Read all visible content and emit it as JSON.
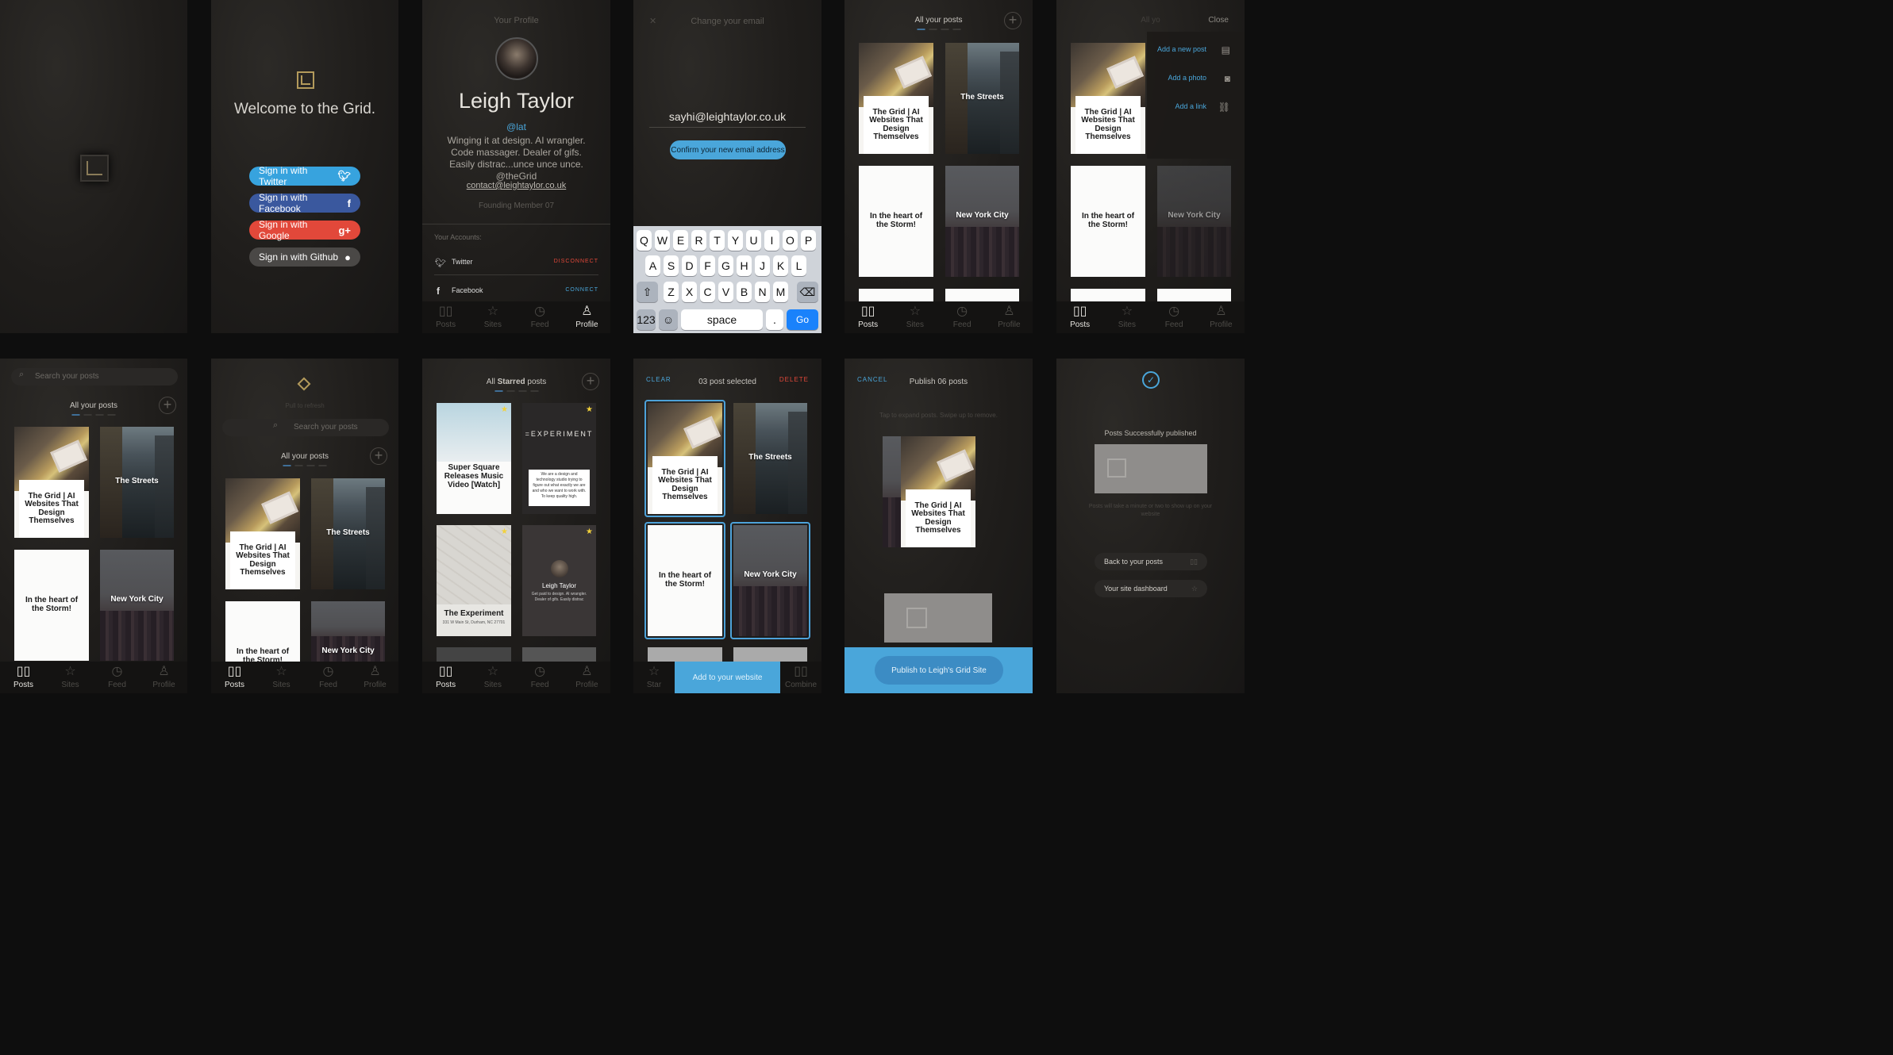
{
  "accent_blue": "#4aa6da",
  "s1": {
    "logo": "grid-logo"
  },
  "s2": {
    "welcome": "Welcome to the Grid.",
    "buttons": [
      {
        "label": "Sign in with Twitter",
        "icon": "twitter-icon",
        "color": "#37a3de"
      },
      {
        "label": "Sign in with Facebook",
        "icon": "facebook-icon",
        "color": "#3a589e"
      },
      {
        "label": "Sign in with Google",
        "icon": "google-plus-icon",
        "color": "#e2483a"
      },
      {
        "label": "Sign in with Github",
        "icon": "github-icon",
        "color": "#4a4846"
      }
    ]
  },
  "s3": {
    "header": "Your Profile",
    "name": "Leigh Taylor",
    "handle": "@lat",
    "bio": "Winging it at design. AI wrangler. Code massager. Dealer of gifs. Easily distrac...unce unce unce. @theGrid",
    "email": "contact@leightaylor.co.uk",
    "member": "Founding Member 07",
    "accounts_label": "Your Accounts:",
    "accounts": [
      {
        "name": "Twitter",
        "action": "DISCONNECT"
      },
      {
        "name": "Facebook",
        "action": "CONNECT"
      }
    ]
  },
  "tabs": [
    "Posts",
    "Sites",
    "Feed",
    "Profile"
  ],
  "s4": {
    "header": "Change your email",
    "email": "sayhi@leightaylor.co.uk",
    "confirm": "Confirm your new email address",
    "row1": [
      "Q",
      "W",
      "E",
      "R",
      "T",
      "Y",
      "U",
      "I",
      "O",
      "P"
    ],
    "row2": [
      "A",
      "S",
      "D",
      "F",
      "G",
      "H",
      "J",
      "K",
      "L"
    ],
    "row3": [
      "Z",
      "X",
      "C",
      "V",
      "B",
      "N",
      "M"
    ],
    "num": "123",
    "space": "space",
    "dot": ".",
    "go": "Go"
  },
  "posts": {
    "grid": "The Grid | AI Websites That Design Themselves",
    "streets": "The Streets",
    "heart": "In the heart of the Storm!",
    "nyc": "New York City"
  },
  "s5": {
    "header": "All your posts"
  },
  "s6": {
    "header": "All yo",
    "close": "Close",
    "menu": [
      {
        "label": "Add a new post",
        "icon": "document-icon"
      },
      {
        "label": "Add a photo",
        "icon": "camera-icon"
      },
      {
        "label": "Add a link",
        "icon": "link-icon"
      }
    ]
  },
  "s7": {
    "search": "Search your posts",
    "header": "All your posts"
  },
  "s8": {
    "pull": "Pull to refresh",
    "search": "Search your posts",
    "header": "All your posts"
  },
  "s9": {
    "header_a": "All ",
    "header_b": "Starred",
    "header_c": " posts",
    "c1": "Super Square Releases Music Video [Watch]",
    "c2": "=EXPERIMENT",
    "c2_text": "We are a design and technology studio trying to figure out what exactly we are and who we want to work with. To keep quality high.",
    "c3": "The Experiment",
    "c3_sub": "331 W Main St, Durham, NC 27701",
    "c4_name": "Leigh Taylor",
    "c4_text": "Get paid to design. AI wrangler. Dealer of gifs. Easily distrac"
  },
  "s10": {
    "clear": "CLEAR",
    "selected": "03 post selected",
    "delete": "DELETE",
    "add": "Add to your website",
    "star": "Star",
    "combine": "Combine"
  },
  "s11": {
    "cancel": "CANCEL",
    "header": "Publish 06 posts",
    "hint": "Tap to expand posts. Swipe up to remove.",
    "publish": "Publish to Leigh's Grid Site"
  },
  "s12": {
    "success": "Posts Successfully published",
    "note": "Posts will take a minute or two to show up on your website",
    "back": "Back to your posts",
    "dash": "Your site dashboard"
  }
}
